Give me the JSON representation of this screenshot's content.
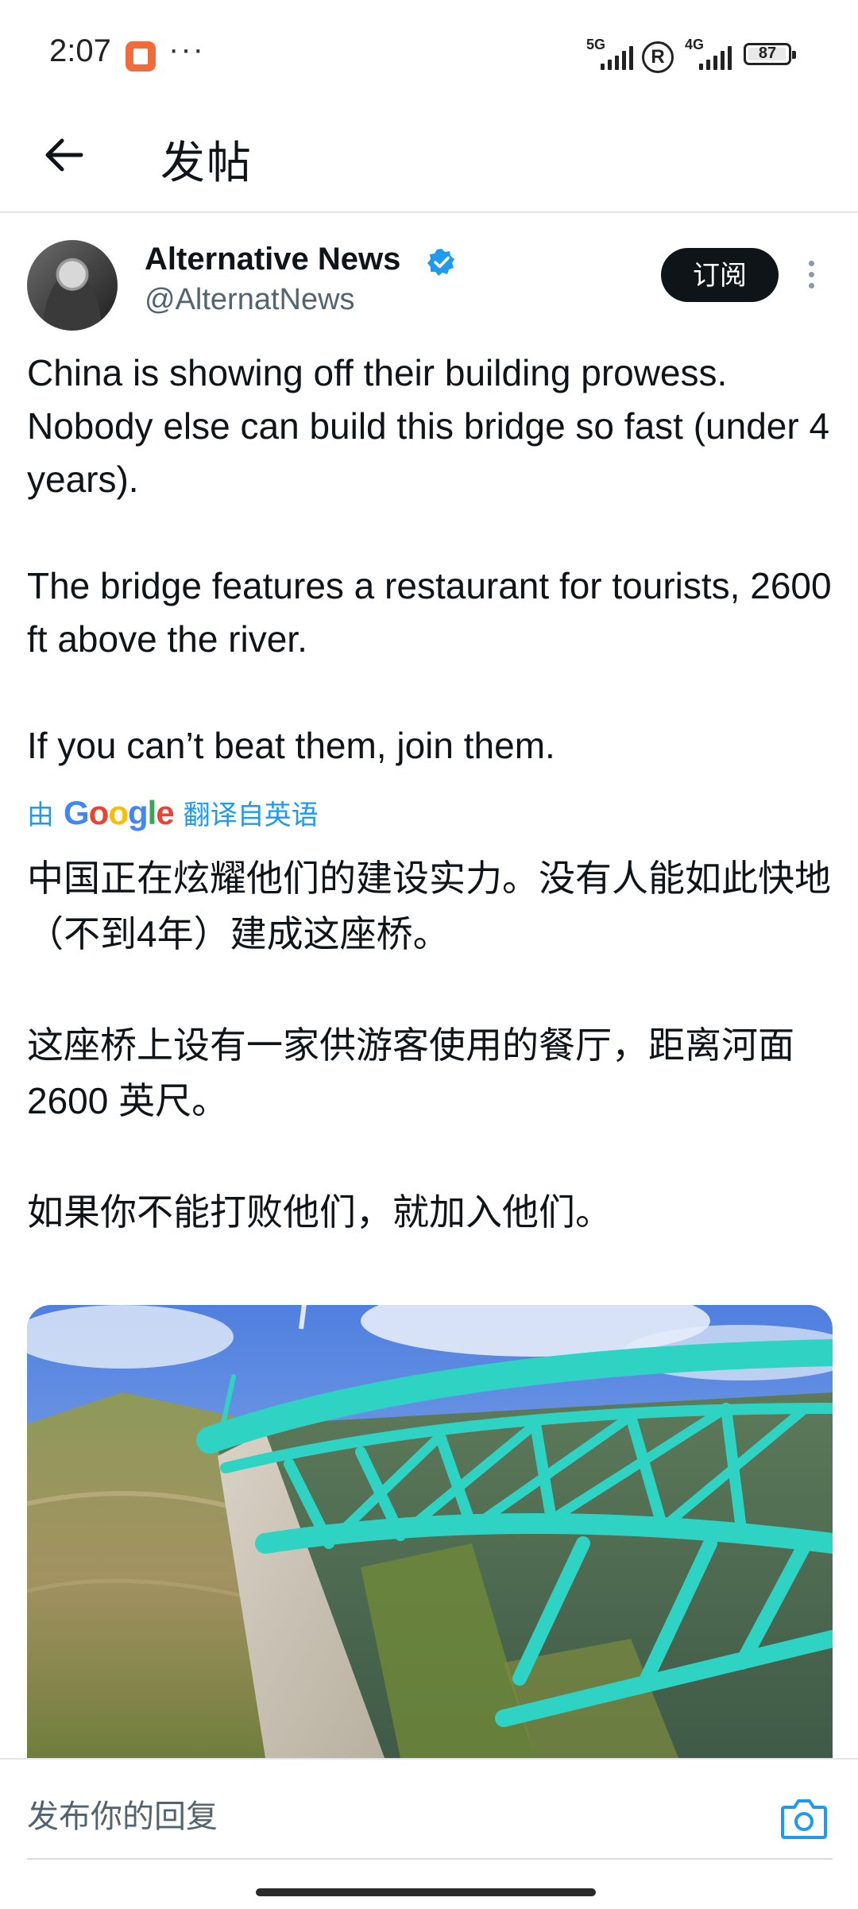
{
  "status_bar": {
    "time": "2:07",
    "more": "···",
    "network_1": "5G",
    "network_2": "4G",
    "registered": "R",
    "battery": "87"
  },
  "header": {
    "title": "发帖"
  },
  "tweet": {
    "author_name": "Alternative News",
    "handle": "@AlternatNews",
    "subscribe_label": "订阅",
    "paragraphs": [
      "China is showing off their building prowess. Nobody else can build this bridge so fast (under 4 years).",
      "The bridge features a restaurant for tourists, 2600 ft above the river.",
      "If you can’t beat them, join them."
    ],
    "translation": {
      "prefix": "由",
      "provider": "Google",
      "suffix": "翻译自英语"
    },
    "translated_paragraphs": [
      "中国正在炫耀他们的建设实力。没有人能如此快地（不到4年）建成这座桥。",
      "这座桥上设有一家供游客使用的餐厅，距离河面 2600 英尺。",
      "如果你不能打败他们，就加入他们。"
    ]
  },
  "reply": {
    "placeholder": "发布你的回复"
  },
  "colors": {
    "accent": "#1d9bf0",
    "text_primary": "#0f1419",
    "text_secondary": "#536471",
    "bridge_teal": "#2fd3c3"
  },
  "icons": {
    "back": "arrow-left-icon",
    "verified": "verified-badge-icon",
    "more": "more-vertical-icon",
    "camera": "camera-icon"
  }
}
